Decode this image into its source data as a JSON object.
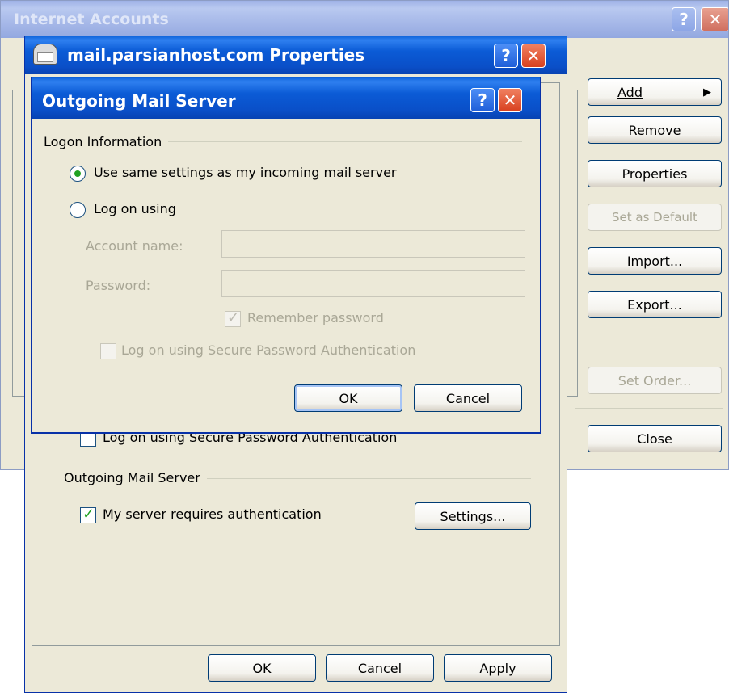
{
  "internet_accounts": {
    "title": "Internet Accounts",
    "help": "?",
    "close": "✕",
    "buttons": {
      "add": "Add",
      "remove": "Remove",
      "properties": "Properties",
      "set_default": "Set as Default",
      "import": "Import...",
      "export": "Export...",
      "set_order": "Set Order...",
      "close": "Close"
    }
  },
  "properties": {
    "title": "mail.parsianhost.com Properties",
    "help": "?",
    "close": "✕",
    "spa_label": "Log on using Secure Password Authentication",
    "outgoing_group": "Outgoing Mail Server",
    "requires_auth_label": "My server requires authentication",
    "requires_auth_checked": true,
    "settings_button": "Settings...",
    "ok": "OK",
    "cancel": "Cancel",
    "apply": "Apply"
  },
  "outgoing": {
    "title": "Outgoing Mail Server",
    "help": "?",
    "close": "✕",
    "logon_group": "Logon Information",
    "use_same_label": "Use same settings as my incoming mail server",
    "log_on_using_label": "Log on using",
    "selected": "use_same",
    "account_name_label": "Account name:",
    "account_name_value": "",
    "password_label": "Password:",
    "password_value": "",
    "remember_password_label": "Remember password",
    "remember_password_checked": true,
    "spa_label": "Log on using Secure Password Authentication",
    "spa_checked": false,
    "ok": "OK",
    "cancel": "Cancel"
  },
  "colors": {
    "titlebar_active": "#0a5fd8",
    "dialog_face": "#ece9d8",
    "button_border": "#003c74",
    "check_mark": "#21a121"
  }
}
